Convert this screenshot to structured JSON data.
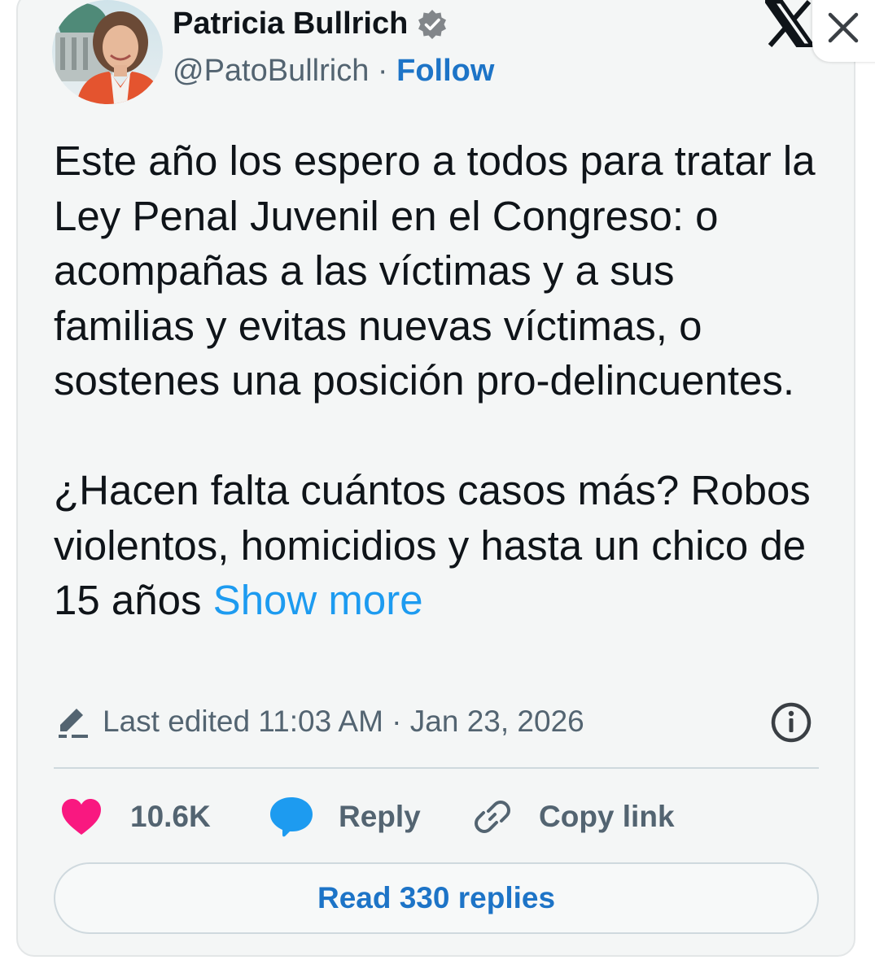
{
  "author": {
    "name": "Patricia Bullrich",
    "handle": "@PatoBullrich",
    "separator": " · ",
    "follow_label": "Follow"
  },
  "tweet": {
    "paragraphs": [
      "Este año los espero a todos para tratar la Ley Penal Juvenil en el Congreso: o acompañas a las víctimas y a sus familias y evitas nuevas víctimas, o sostenes una posición pro-delincuentes.",
      "¿Hacen falta cuántos casos más? Robos violentos, homicidios y hasta un chico de 15 años"
    ],
    "show_more": "Show more"
  },
  "meta": {
    "edited": "Last edited 11:03 AM · Jan 23, 2026"
  },
  "actions": {
    "likes": "10.6K",
    "reply": "Reply",
    "copy_link": "Copy link"
  },
  "read_replies": "Read 330 replies",
  "icons": {
    "verified": "verified-badge-icon",
    "x_logo": "x-logo-icon",
    "close": "close-icon",
    "pencil": "pencil-icon",
    "info": "info-icon",
    "heart": "heart-icon",
    "reply": "speech-bubble-icon",
    "link": "link-icon"
  },
  "colors": {
    "link_blue": "#1d74c7",
    "show_more_blue": "#1d9bf0",
    "heart_pink": "#f91880",
    "reply_blue": "#1d9bf0",
    "text_primary": "#0f1419",
    "text_secondary": "#536471"
  }
}
